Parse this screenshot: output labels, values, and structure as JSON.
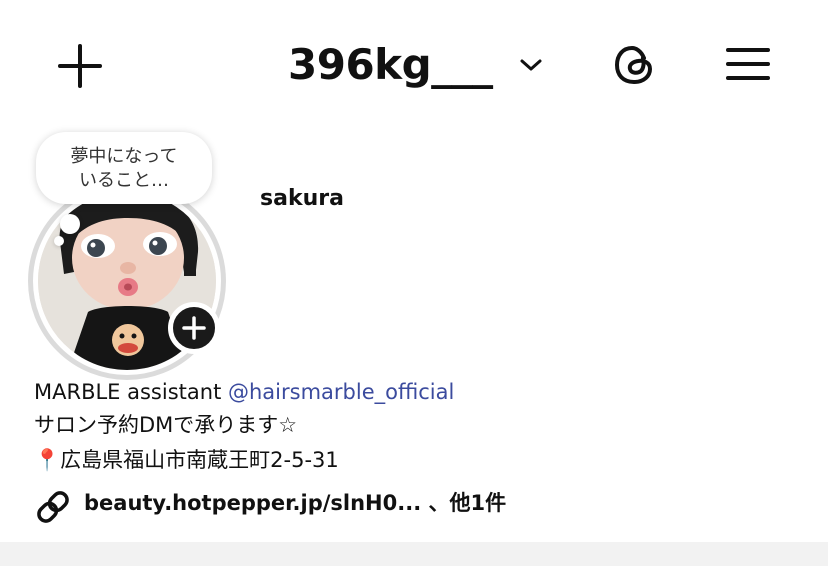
{
  "header": {
    "username": "396kg___",
    "icons": {
      "create": "plus-icon",
      "switch": "chevron-down-icon",
      "threads": "threads-icon",
      "menu": "hamburger-menu-icon"
    }
  },
  "profile": {
    "note": "夢中になって\nいること…",
    "display_name": "sakura",
    "avatar": "doll-avatar-photo"
  },
  "bio": {
    "line1_prefix": "MARBLE assistant ",
    "mention": "@hairsmarble_official",
    "line2": "サロン予約DMで承ります☆",
    "line3": "📍広島県福山市南蔵王町2-5-31",
    "link": "beauty.hotpepper.jp/slnH0... 、他1件"
  },
  "colors": {
    "mention": "#3b4b9e",
    "text": "#111111",
    "ring": "#dbdbdb"
  }
}
